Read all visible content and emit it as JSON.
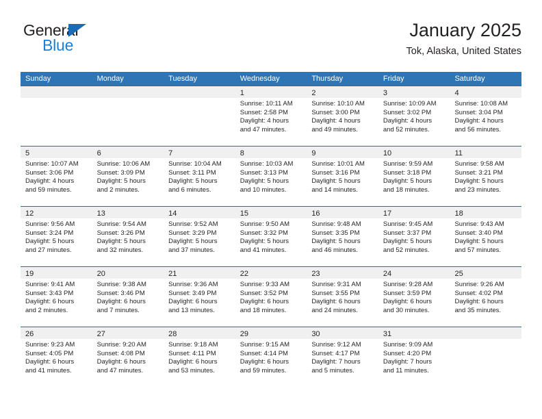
{
  "brand": {
    "name_top": "General",
    "name_bottom": "Blue",
    "color_dark": "#231f20",
    "color_blue": "#1b7fd4"
  },
  "header": {
    "title": "January 2025",
    "subtitle": "Tok, Alaska, United States"
  },
  "theme": {
    "header_blue": "#2e75b6",
    "row_divider_blue": "#1f6cb0",
    "day_band_gray": "#f0f0f0"
  },
  "weekdays": [
    "Sunday",
    "Monday",
    "Tuesday",
    "Wednesday",
    "Thursday",
    "Friday",
    "Saturday"
  ],
  "weeks": [
    [
      {
        "day": "",
        "lines": []
      },
      {
        "day": "",
        "lines": []
      },
      {
        "day": "",
        "lines": []
      },
      {
        "day": "1",
        "lines": [
          "Sunrise: 10:11 AM",
          "Sunset: 2:58 PM",
          "Daylight: 4 hours",
          "and 47 minutes."
        ]
      },
      {
        "day": "2",
        "lines": [
          "Sunrise: 10:10 AM",
          "Sunset: 3:00 PM",
          "Daylight: 4 hours",
          "and 49 minutes."
        ]
      },
      {
        "day": "3",
        "lines": [
          "Sunrise: 10:09 AM",
          "Sunset: 3:02 PM",
          "Daylight: 4 hours",
          "and 52 minutes."
        ]
      },
      {
        "day": "4",
        "lines": [
          "Sunrise: 10:08 AM",
          "Sunset: 3:04 PM",
          "Daylight: 4 hours",
          "and 56 minutes."
        ]
      }
    ],
    [
      {
        "day": "5",
        "lines": [
          "Sunrise: 10:07 AM",
          "Sunset: 3:06 PM",
          "Daylight: 4 hours",
          "and 59 minutes."
        ]
      },
      {
        "day": "6",
        "lines": [
          "Sunrise: 10:06 AM",
          "Sunset: 3:09 PM",
          "Daylight: 5 hours",
          "and 2 minutes."
        ]
      },
      {
        "day": "7",
        "lines": [
          "Sunrise: 10:04 AM",
          "Sunset: 3:11 PM",
          "Daylight: 5 hours",
          "and 6 minutes."
        ]
      },
      {
        "day": "8",
        "lines": [
          "Sunrise: 10:03 AM",
          "Sunset: 3:13 PM",
          "Daylight: 5 hours",
          "and 10 minutes."
        ]
      },
      {
        "day": "9",
        "lines": [
          "Sunrise: 10:01 AM",
          "Sunset: 3:16 PM",
          "Daylight: 5 hours",
          "and 14 minutes."
        ]
      },
      {
        "day": "10",
        "lines": [
          "Sunrise: 9:59 AM",
          "Sunset: 3:18 PM",
          "Daylight: 5 hours",
          "and 18 minutes."
        ]
      },
      {
        "day": "11",
        "lines": [
          "Sunrise: 9:58 AM",
          "Sunset: 3:21 PM",
          "Daylight: 5 hours",
          "and 23 minutes."
        ]
      }
    ],
    [
      {
        "day": "12",
        "lines": [
          "Sunrise: 9:56 AM",
          "Sunset: 3:24 PM",
          "Daylight: 5 hours",
          "and 27 minutes."
        ]
      },
      {
        "day": "13",
        "lines": [
          "Sunrise: 9:54 AM",
          "Sunset: 3:26 PM",
          "Daylight: 5 hours",
          "and 32 minutes."
        ]
      },
      {
        "day": "14",
        "lines": [
          "Sunrise: 9:52 AM",
          "Sunset: 3:29 PM",
          "Daylight: 5 hours",
          "and 37 minutes."
        ]
      },
      {
        "day": "15",
        "lines": [
          "Sunrise: 9:50 AM",
          "Sunset: 3:32 PM",
          "Daylight: 5 hours",
          "and 41 minutes."
        ]
      },
      {
        "day": "16",
        "lines": [
          "Sunrise: 9:48 AM",
          "Sunset: 3:35 PM",
          "Daylight: 5 hours",
          "and 46 minutes."
        ]
      },
      {
        "day": "17",
        "lines": [
          "Sunrise: 9:45 AM",
          "Sunset: 3:37 PM",
          "Daylight: 5 hours",
          "and 52 minutes."
        ]
      },
      {
        "day": "18",
        "lines": [
          "Sunrise: 9:43 AM",
          "Sunset: 3:40 PM",
          "Daylight: 5 hours",
          "and 57 minutes."
        ]
      }
    ],
    [
      {
        "day": "19",
        "lines": [
          "Sunrise: 9:41 AM",
          "Sunset: 3:43 PM",
          "Daylight: 6 hours",
          "and 2 minutes."
        ]
      },
      {
        "day": "20",
        "lines": [
          "Sunrise: 9:38 AM",
          "Sunset: 3:46 PM",
          "Daylight: 6 hours",
          "and 7 minutes."
        ]
      },
      {
        "day": "21",
        "lines": [
          "Sunrise: 9:36 AM",
          "Sunset: 3:49 PM",
          "Daylight: 6 hours",
          "and 13 minutes."
        ]
      },
      {
        "day": "22",
        "lines": [
          "Sunrise: 9:33 AM",
          "Sunset: 3:52 PM",
          "Daylight: 6 hours",
          "and 18 minutes."
        ]
      },
      {
        "day": "23",
        "lines": [
          "Sunrise: 9:31 AM",
          "Sunset: 3:55 PM",
          "Daylight: 6 hours",
          "and 24 minutes."
        ]
      },
      {
        "day": "24",
        "lines": [
          "Sunrise: 9:28 AM",
          "Sunset: 3:59 PM",
          "Daylight: 6 hours",
          "and 30 minutes."
        ]
      },
      {
        "day": "25",
        "lines": [
          "Sunrise: 9:26 AM",
          "Sunset: 4:02 PM",
          "Daylight: 6 hours",
          "and 35 minutes."
        ]
      }
    ],
    [
      {
        "day": "26",
        "lines": [
          "Sunrise: 9:23 AM",
          "Sunset: 4:05 PM",
          "Daylight: 6 hours",
          "and 41 minutes."
        ]
      },
      {
        "day": "27",
        "lines": [
          "Sunrise: 9:20 AM",
          "Sunset: 4:08 PM",
          "Daylight: 6 hours",
          "and 47 minutes."
        ]
      },
      {
        "day": "28",
        "lines": [
          "Sunrise: 9:18 AM",
          "Sunset: 4:11 PM",
          "Daylight: 6 hours",
          "and 53 minutes."
        ]
      },
      {
        "day": "29",
        "lines": [
          "Sunrise: 9:15 AM",
          "Sunset: 4:14 PM",
          "Daylight: 6 hours",
          "and 59 minutes."
        ]
      },
      {
        "day": "30",
        "lines": [
          "Sunrise: 9:12 AM",
          "Sunset: 4:17 PM",
          "Daylight: 7 hours",
          "and 5 minutes."
        ]
      },
      {
        "day": "31",
        "lines": [
          "Sunrise: 9:09 AM",
          "Sunset: 4:20 PM",
          "Daylight: 7 hours",
          "and 11 minutes."
        ]
      },
      {
        "day": "",
        "lines": []
      }
    ]
  ]
}
